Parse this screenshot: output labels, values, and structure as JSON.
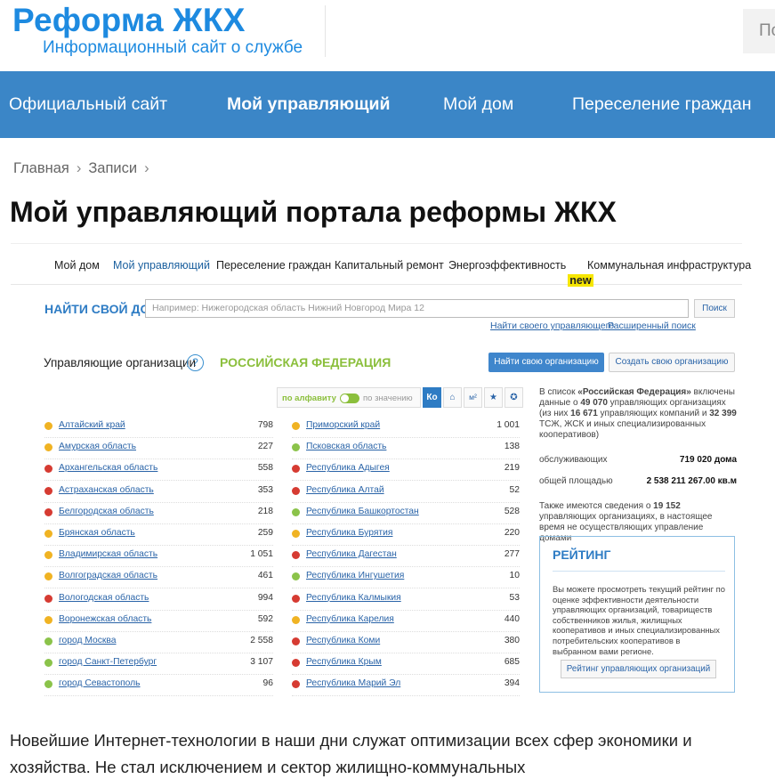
{
  "header": {
    "title": "Реформа ЖКХ",
    "subtitle": "Информационный сайт о службе",
    "search_stub": "По"
  },
  "nav": [
    "Официальный сайт",
    "Мой управляющий",
    "Мой дом",
    "Переселение граждан"
  ],
  "breadcrumb": {
    "home": "Главная",
    "section": "Записи",
    "sep": "›"
  },
  "page_title": "Мой управляющий портала реформы ЖКХ",
  "inner_nav": {
    "items": [
      "Мой дом",
      "Мой управляющий",
      "Переселение граждан",
      "Капитальный ремонт",
      "Энергоэффективность",
      "Коммунальная инфраструктура"
    ],
    "new_badge": "new"
  },
  "find": {
    "label": "НАЙТИ СВОЙ ДОМ",
    "placeholder": "Например: Нижегородская область Нижний Новгород Мира 12",
    "button": "Поиск",
    "link1": "Найти своего управляющего",
    "link2": "Расширенный поиск"
  },
  "orgs": {
    "label": "Управляющие организации",
    "help": "?",
    "region": "РОССИЙСКАЯ ФЕДЕРАЦИЯ",
    "find_btn": "Найти свою организацию",
    "create_btn": "Создать свою организацию"
  },
  "sort": {
    "alpha": "по алфавиту",
    "value": "по значению",
    "icons": [
      "Ко",
      "⌂",
      "м²",
      "★",
      "✪"
    ]
  },
  "colors": {
    "yellow": "#f0b323",
    "green": "#8bc34a",
    "red": "#d63b32",
    "blue": "#2e7cc4"
  },
  "regions_left": [
    {
      "name": "Алтайский край",
      "count": "798",
      "color": "yellow"
    },
    {
      "name": "Амурская область",
      "count": "227",
      "color": "yellow"
    },
    {
      "name": "Архангельская область",
      "count": "558",
      "color": "red"
    },
    {
      "name": "Астраханская область",
      "count": "353",
      "color": "red"
    },
    {
      "name": "Белгородская область",
      "count": "218",
      "color": "red"
    },
    {
      "name": "Брянская область",
      "count": "259",
      "color": "yellow"
    },
    {
      "name": "Владимирская область",
      "count": "1 051",
      "color": "yellow"
    },
    {
      "name": "Волгоградская область",
      "count": "461",
      "color": "yellow"
    },
    {
      "name": "Вологодская область",
      "count": "994",
      "color": "red"
    },
    {
      "name": "Воронежская область",
      "count": "592",
      "color": "yellow"
    },
    {
      "name": "город Москва",
      "count": "2 558",
      "color": "green"
    },
    {
      "name": "город Санкт-Петербург",
      "count": "3 107",
      "color": "green"
    },
    {
      "name": "город Севастополь",
      "count": "96",
      "color": "green"
    }
  ],
  "regions_right": [
    {
      "name": "Приморский край",
      "count": "1 001",
      "color": "yellow"
    },
    {
      "name": "Псковская область",
      "count": "138",
      "color": "green"
    },
    {
      "name": "Республика Адыгея",
      "count": "219",
      "color": "red"
    },
    {
      "name": "Республика Алтай",
      "count": "52",
      "color": "red"
    },
    {
      "name": "Республика Башкортостан",
      "count": "528",
      "color": "green"
    },
    {
      "name": "Республика Бурятия",
      "count": "220",
      "color": "yellow"
    },
    {
      "name": "Республика Дагестан",
      "count": "277",
      "color": "red"
    },
    {
      "name": "Республика Ингушетия",
      "count": "10",
      "color": "green"
    },
    {
      "name": "Республика Калмыкия",
      "count": "53",
      "color": "red"
    },
    {
      "name": "Республика Карелия",
      "count": "440",
      "color": "yellow"
    },
    {
      "name": "Республика Коми",
      "count": "380",
      "color": "red"
    },
    {
      "name": "Республика Крым",
      "count": "685",
      "color": "red"
    },
    {
      "name": "Республика Марий Эл",
      "count": "394",
      "color": "red"
    }
  ],
  "side": {
    "p1": {
      "a": "В список ",
      "b": "«Российская Федерация»",
      "c": " включены данные о ",
      "d": "49 070",
      "e": " управляющих организациях (из них ",
      "f": "16 671",
      "g": " управляющих компаний и ",
      "h": "32 399",
      "i": " ТСЖ, ЖСК и иных специализированных кооперативов)"
    },
    "served_label": "обслуживающих",
    "served_value": "719 020 дома",
    "area_label": "общей площадью",
    "area_value": "2 538 211 267.00 кв.м",
    "p2": {
      "a": "Также имеются сведения о ",
      "b": "19 152",
      "c": " управляющих организациях, в настоящее время не осуществляющих управление домами"
    }
  },
  "rating": {
    "title": "РЕЙТИНГ",
    "text": "Вы можете просмотреть текущий рейтинг по оценке эффективности деятельности управляющих организаций, товариществ собственников жилья, жилищных кооперативов и иных специализированных потребительских кооперативов в выбранном вами регионе.",
    "button": "Рейтинг управляющих организаций"
  },
  "body_text": "Новейшие Интернет-технологии в наши дни служат оптимизации всех сфер экономики и хозяйства. Не стал исключением и сектор жилищно-коммунальных"
}
